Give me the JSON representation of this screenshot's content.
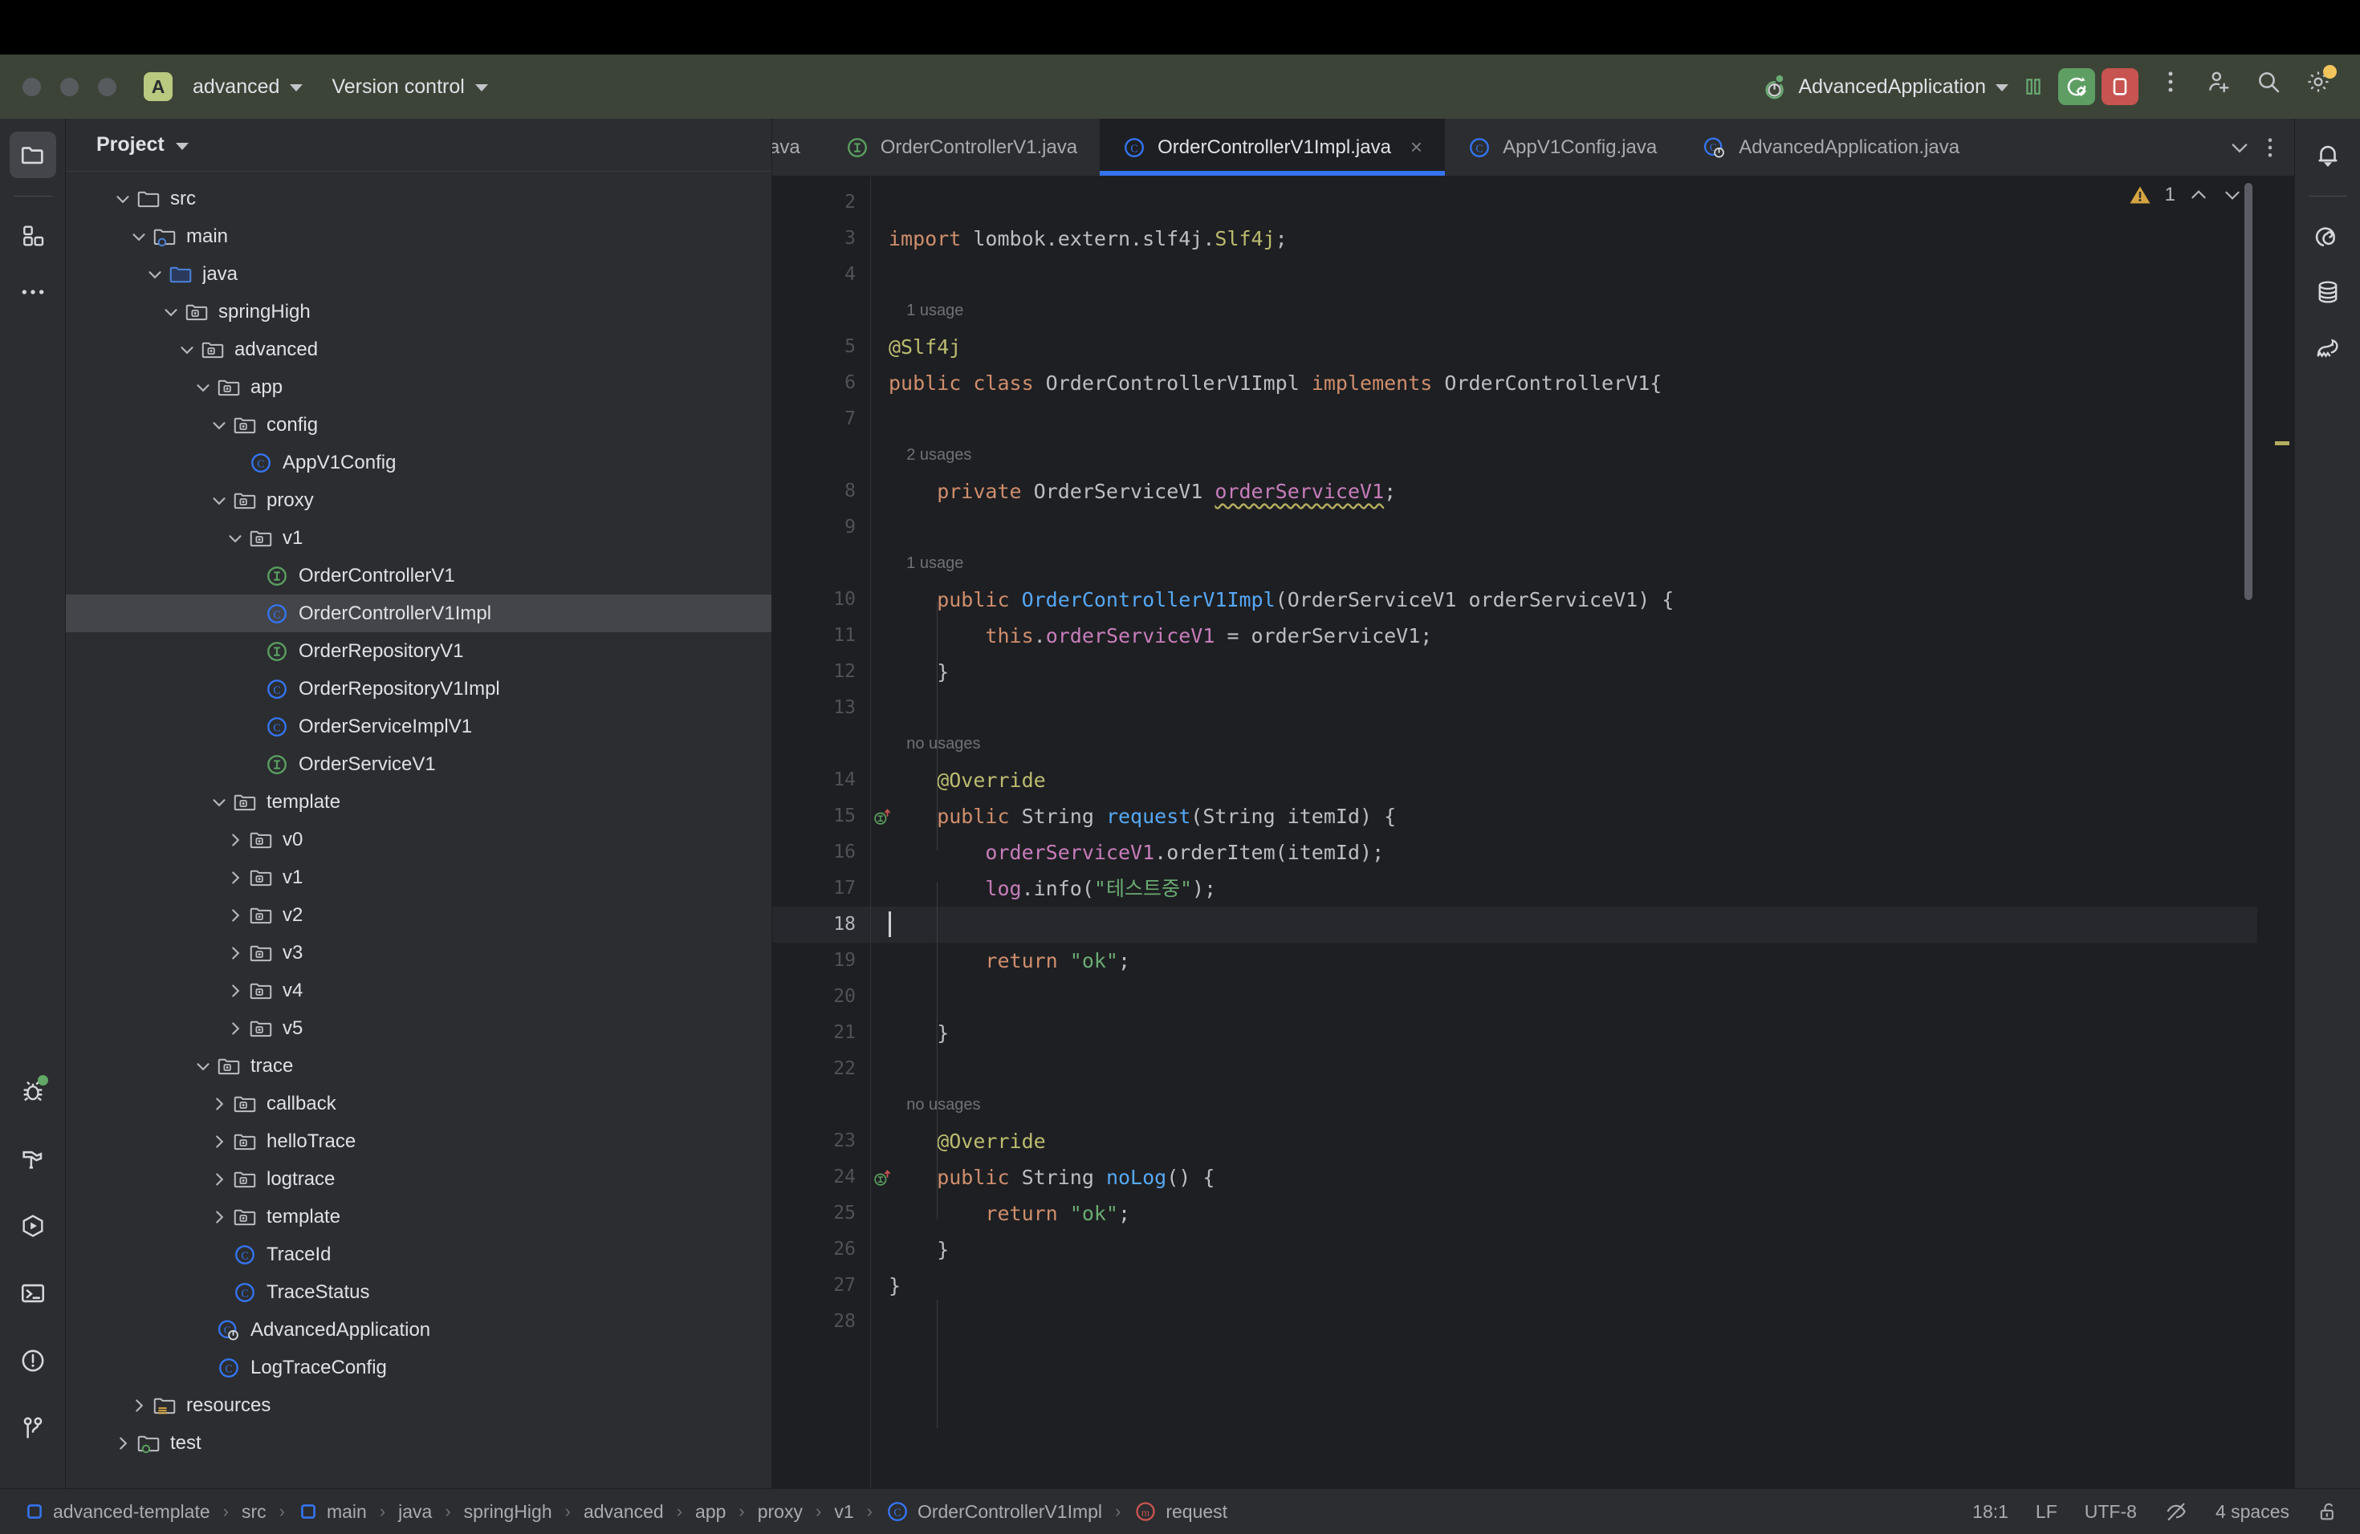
{
  "titlebar": {
    "project_badge": "A",
    "project_name": "advanced",
    "version_control": "Version control",
    "run_config": "AdvancedApplication",
    "icons": {
      "pause": "pause-icon",
      "rerun": "rerun-with-debug-icon",
      "stop": "stop-icon",
      "more": "more-options-icon",
      "account": "add-account-icon",
      "search": "search-everywhere-icon",
      "settings": "settings-gear-icon"
    }
  },
  "left_rail": {
    "top": [
      {
        "name": "project-tool-window",
        "icon": "folder-icon",
        "selected": true
      },
      {
        "name": "commit-tool-window",
        "icon": "grid-squares-icon",
        "selected": false
      },
      {
        "name": "more-tool-windows",
        "icon": "ellipsis-icon",
        "selected": false
      }
    ],
    "bottom": [
      {
        "name": "debug-tool-window",
        "icon": "bug-icon",
        "badge": true
      },
      {
        "name": "build-tool-window",
        "icon": "hammer-icon",
        "badge": false
      },
      {
        "name": "run-tool-window",
        "icon": "run-hexagon-icon",
        "badge": false
      },
      {
        "name": "terminal-tool-window",
        "icon": "terminal-icon",
        "badge": false
      },
      {
        "name": "problems-tool-window",
        "icon": "warning-circle-icon",
        "badge": false
      },
      {
        "name": "git-tool-window",
        "icon": "git-branch-icon",
        "badge": false
      }
    ]
  },
  "right_rail": [
    {
      "name": "notifications",
      "icon": "bell-icon"
    },
    {
      "name": "spring-tool-window",
      "icon": "spring-spiral-icon"
    },
    {
      "name": "database-tool-window",
      "icon": "database-icon"
    },
    {
      "name": "gradle-tool-window",
      "icon": "gradle-elephant-icon"
    }
  ],
  "project_panel": {
    "title": "Project",
    "tree": [
      {
        "label": "src",
        "depth": 2,
        "arrow": "down",
        "icon": "folder",
        "selected": false
      },
      {
        "label": "main",
        "depth": 3,
        "arrow": "down",
        "icon": "folder-src",
        "selected": false
      },
      {
        "label": "java",
        "depth": 4,
        "arrow": "down",
        "icon": "folder-java",
        "selected": false
      },
      {
        "label": "springHigh",
        "depth": 5,
        "arrow": "down",
        "icon": "package",
        "selected": false
      },
      {
        "label": "advanced",
        "depth": 6,
        "arrow": "down",
        "icon": "package",
        "selected": false
      },
      {
        "label": "app",
        "depth": 7,
        "arrow": "down",
        "icon": "package",
        "selected": false
      },
      {
        "label": "config",
        "depth": 8,
        "arrow": "down",
        "icon": "package",
        "selected": false
      },
      {
        "label": "AppV1Config",
        "depth": 9,
        "arrow": "none",
        "icon": "class",
        "selected": false
      },
      {
        "label": "proxy",
        "depth": 8,
        "arrow": "down",
        "icon": "package",
        "selected": false
      },
      {
        "label": "v1",
        "depth": 9,
        "arrow": "down",
        "icon": "package",
        "selected": false
      },
      {
        "label": "OrderControllerV1",
        "depth": 10,
        "arrow": "none",
        "icon": "interface",
        "selected": false
      },
      {
        "label": "OrderControllerV1Impl",
        "depth": 10,
        "arrow": "none",
        "icon": "class",
        "selected": true
      },
      {
        "label": "OrderRepositoryV1",
        "depth": 10,
        "arrow": "none",
        "icon": "interface",
        "selected": false
      },
      {
        "label": "OrderRepositoryV1Impl",
        "depth": 10,
        "arrow": "none",
        "icon": "class",
        "selected": false
      },
      {
        "label": "OrderServiceImplV1",
        "depth": 10,
        "arrow": "none",
        "icon": "class",
        "selected": false
      },
      {
        "label": "OrderServiceV1",
        "depth": 10,
        "arrow": "none",
        "icon": "interface",
        "selected": false
      },
      {
        "label": "template",
        "depth": 8,
        "arrow": "down",
        "icon": "package",
        "selected": false
      },
      {
        "label": "v0",
        "depth": 9,
        "arrow": "right",
        "icon": "package",
        "selected": false
      },
      {
        "label": "v1",
        "depth": 9,
        "arrow": "right",
        "icon": "package",
        "selected": false
      },
      {
        "label": "v2",
        "depth": 9,
        "arrow": "right",
        "icon": "package",
        "selected": false
      },
      {
        "label": "v3",
        "depth": 9,
        "arrow": "right",
        "icon": "package",
        "selected": false
      },
      {
        "label": "v4",
        "depth": 9,
        "arrow": "right",
        "icon": "package",
        "selected": false
      },
      {
        "label": "v5",
        "depth": 9,
        "arrow": "right",
        "icon": "package",
        "selected": false
      },
      {
        "label": "trace",
        "depth": 7,
        "arrow": "down",
        "icon": "package",
        "selected": false
      },
      {
        "label": "callback",
        "depth": 8,
        "arrow": "right",
        "icon": "package",
        "selected": false
      },
      {
        "label": "helloTrace",
        "depth": 8,
        "arrow": "right",
        "icon": "package",
        "selected": false
      },
      {
        "label": "logtrace",
        "depth": 8,
        "arrow": "right",
        "icon": "package",
        "selected": false
      },
      {
        "label": "template",
        "depth": 8,
        "arrow": "right",
        "icon": "package",
        "selected": false
      },
      {
        "label": "TraceId",
        "depth": 8,
        "arrow": "none",
        "icon": "class",
        "selected": false
      },
      {
        "label": "TraceStatus",
        "depth": 8,
        "arrow": "none",
        "icon": "class",
        "selected": false
      },
      {
        "label": "AdvancedApplication",
        "depth": 7,
        "arrow": "none",
        "icon": "spring-class",
        "selected": false
      },
      {
        "label": "LogTraceConfig",
        "depth": 7,
        "arrow": "none",
        "icon": "class",
        "selected": false
      },
      {
        "label": "resources",
        "depth": 3,
        "arrow": "right",
        "icon": "folder-res",
        "selected": false
      },
      {
        "label": "test",
        "depth": 2,
        "arrow": "right",
        "icon": "folder-test",
        "selected": false
      }
    ]
  },
  "editor": {
    "tabs": [
      {
        "label": "ava",
        "icon": "none",
        "active": false,
        "closable": false,
        "clipped": true
      },
      {
        "label": "OrderControllerV1.java",
        "icon": "interface",
        "active": false,
        "closable": false,
        "clipped": false
      },
      {
        "label": "OrderControllerV1Impl.java",
        "icon": "class",
        "active": true,
        "closable": true,
        "clipped": false
      },
      {
        "label": "AppV1Config.java",
        "icon": "class",
        "active": false,
        "closable": false,
        "clipped": false
      },
      {
        "label": "AdvancedApplication.java",
        "icon": "spring-class",
        "active": false,
        "closable": false,
        "clipped": false
      }
    ],
    "tabbar_actions": [
      {
        "name": "tab-list-chevron",
        "icon": "chevron-down-icon"
      },
      {
        "name": "tab-options",
        "icon": "vertical-ellipsis-icon"
      }
    ],
    "inspection": {
      "warning_icon": "warning-triangle-icon",
      "warning_count": "1",
      "prev": "chevron-up-icon",
      "next": "chevron-down-icon"
    },
    "lines": [
      {
        "num": "2",
        "hint": null,
        "mark": null,
        "current": false,
        "tokens": []
      },
      {
        "num": "3",
        "hint": null,
        "mark": null,
        "current": false,
        "tokens": [
          {
            "t": "import ",
            "c": "kw"
          },
          {
            "t": "lombok.extern.slf4j.",
            "c": "plain"
          },
          {
            "t": "Slf4j",
            "c": "ann"
          },
          {
            "t": ";",
            "c": "plain"
          }
        ]
      },
      {
        "num": "4",
        "hint": null,
        "mark": null,
        "current": false,
        "tokens": []
      },
      {
        "num": "5",
        "hint": "1 usage",
        "mark": null,
        "current": false,
        "tokens": [
          {
            "t": "@Slf4j",
            "c": "ann"
          }
        ]
      },
      {
        "num": "6",
        "hint": null,
        "mark": null,
        "current": false,
        "tokens": [
          {
            "t": "public class ",
            "c": "kw"
          },
          {
            "t": "OrderControllerV1Impl ",
            "c": "plain"
          },
          {
            "t": "implements ",
            "c": "kw"
          },
          {
            "t": "OrderControllerV1{",
            "c": "plain"
          }
        ]
      },
      {
        "num": "7",
        "hint": null,
        "mark": null,
        "current": false,
        "tokens": []
      },
      {
        "num": "8",
        "hint": "2 usages",
        "mark": null,
        "current": false,
        "tokens": [
          {
            "t": "    private ",
            "c": "kw"
          },
          {
            "t": "OrderServiceV1 ",
            "c": "plain"
          },
          {
            "t": "orderServiceV1",
            "c": "fld wavy"
          },
          {
            "t": ";",
            "c": "plain"
          }
        ]
      },
      {
        "num": "9",
        "hint": null,
        "mark": null,
        "current": false,
        "tokens": []
      },
      {
        "num": "10",
        "hint": "1 usage",
        "mark": null,
        "current": false,
        "tokens": [
          {
            "t": "    public ",
            "c": "kw"
          },
          {
            "t": "OrderControllerV1Impl",
            "c": "meth"
          },
          {
            "t": "(OrderServiceV1 orderServiceV1) {",
            "c": "plain"
          }
        ]
      },
      {
        "num": "11",
        "hint": null,
        "mark": null,
        "current": false,
        "tokens": [
          {
            "t": "        this",
            "c": "kw"
          },
          {
            "t": ".",
            "c": "plain"
          },
          {
            "t": "orderServiceV1",
            "c": "fld"
          },
          {
            "t": " = orderServiceV1;",
            "c": "plain"
          }
        ]
      },
      {
        "num": "12",
        "hint": null,
        "mark": null,
        "current": false,
        "tokens": [
          {
            "t": "    }",
            "c": "plain"
          }
        ]
      },
      {
        "num": "13",
        "hint": null,
        "mark": null,
        "current": false,
        "tokens": []
      },
      {
        "num": "14",
        "hint": "no usages",
        "mark": null,
        "current": false,
        "tokens": [
          {
            "t": "    @Override",
            "c": "ann"
          }
        ]
      },
      {
        "num": "15",
        "hint": null,
        "mark": "override",
        "current": false,
        "tokens": [
          {
            "t": "    public ",
            "c": "kw"
          },
          {
            "t": "String ",
            "c": "plain"
          },
          {
            "t": "request",
            "c": "meth"
          },
          {
            "t": "(String itemId) {",
            "c": "plain"
          }
        ]
      },
      {
        "num": "16",
        "hint": null,
        "mark": null,
        "current": false,
        "tokens": [
          {
            "t": "        ",
            "c": "plain"
          },
          {
            "t": "orderServiceV1",
            "c": "fld"
          },
          {
            "t": ".orderItem(itemId);",
            "c": "plain"
          }
        ]
      },
      {
        "num": "17",
        "hint": null,
        "mark": null,
        "current": false,
        "tokens": [
          {
            "t": "        ",
            "c": "plain"
          },
          {
            "t": "log",
            "c": "fld"
          },
          {
            "t": ".info(",
            "c": "plain"
          },
          {
            "t": "\"테스트중\"",
            "c": "str"
          },
          {
            "t": ");",
            "c": "plain"
          }
        ]
      },
      {
        "num": "18",
        "hint": null,
        "mark": null,
        "current": true,
        "tokens": []
      },
      {
        "num": "19",
        "hint": null,
        "mark": null,
        "current": false,
        "tokens": [
          {
            "t": "        return ",
            "c": "kw"
          },
          {
            "t": "\"ok\"",
            "c": "str"
          },
          {
            "t": ";",
            "c": "plain"
          }
        ]
      },
      {
        "num": "20",
        "hint": null,
        "mark": null,
        "current": false,
        "tokens": []
      },
      {
        "num": "21",
        "hint": null,
        "mark": null,
        "current": false,
        "tokens": [
          {
            "t": "    }",
            "c": "plain"
          }
        ]
      },
      {
        "num": "22",
        "hint": null,
        "mark": null,
        "current": false,
        "tokens": []
      },
      {
        "num": "23",
        "hint": "no usages",
        "mark": null,
        "current": false,
        "tokens": [
          {
            "t": "    @Override",
            "c": "ann"
          }
        ]
      },
      {
        "num": "24",
        "hint": null,
        "mark": "override",
        "current": false,
        "tokens": [
          {
            "t": "    public ",
            "c": "kw"
          },
          {
            "t": "String ",
            "c": "plain"
          },
          {
            "t": "noLog",
            "c": "meth"
          },
          {
            "t": "() {",
            "c": "plain"
          }
        ]
      },
      {
        "num": "25",
        "hint": null,
        "mark": null,
        "current": false,
        "tokens": [
          {
            "t": "        return ",
            "c": "kw"
          },
          {
            "t": "\"ok\"",
            "c": "str"
          },
          {
            "t": ";",
            "c": "plain"
          }
        ]
      },
      {
        "num": "26",
        "hint": null,
        "mark": null,
        "current": false,
        "tokens": [
          {
            "t": "    }",
            "c": "plain"
          }
        ]
      },
      {
        "num": "27",
        "hint": null,
        "mark": null,
        "current": false,
        "tokens": [
          {
            "t": "}",
            "c": "plain"
          }
        ]
      },
      {
        "num": "28",
        "hint": null,
        "mark": null,
        "current": false,
        "tokens": []
      }
    ]
  },
  "statusbar": {
    "breadcrumbs": [
      {
        "label": "advanced-template",
        "icon": "module"
      },
      {
        "label": "src",
        "icon": "none"
      },
      {
        "label": "main",
        "icon": "module"
      },
      {
        "label": "java",
        "icon": "none"
      },
      {
        "label": "springHigh",
        "icon": "none"
      },
      {
        "label": "advanced",
        "icon": "none"
      },
      {
        "label": "app",
        "icon": "none"
      },
      {
        "label": "proxy",
        "icon": "none"
      },
      {
        "label": "v1",
        "icon": "none"
      },
      {
        "label": "OrderControllerV1Impl",
        "icon": "class"
      },
      {
        "label": "request",
        "icon": "method"
      }
    ],
    "caret_position": "18:1",
    "line_separator": "LF",
    "encoding": "UTF-8",
    "indent": "4 spaces",
    "read_only_icon": "unlocked-icon",
    "inspection_icon": "inspections-off-icon"
  },
  "colors": {
    "accent": "#3574f0",
    "titlebar_bg": "#3c4438",
    "panel_bg": "#2b2d30",
    "editor_bg": "#1e1f22",
    "selection": "#43454a",
    "run_green": "#5e9e63",
    "stop_red": "#c75450",
    "warning": "#c9a227",
    "keyword": "#cf8e6d",
    "string": "#6aab73",
    "annotation": "#bcbc70",
    "field": "#c77dbb",
    "method": "#56a8f5"
  }
}
